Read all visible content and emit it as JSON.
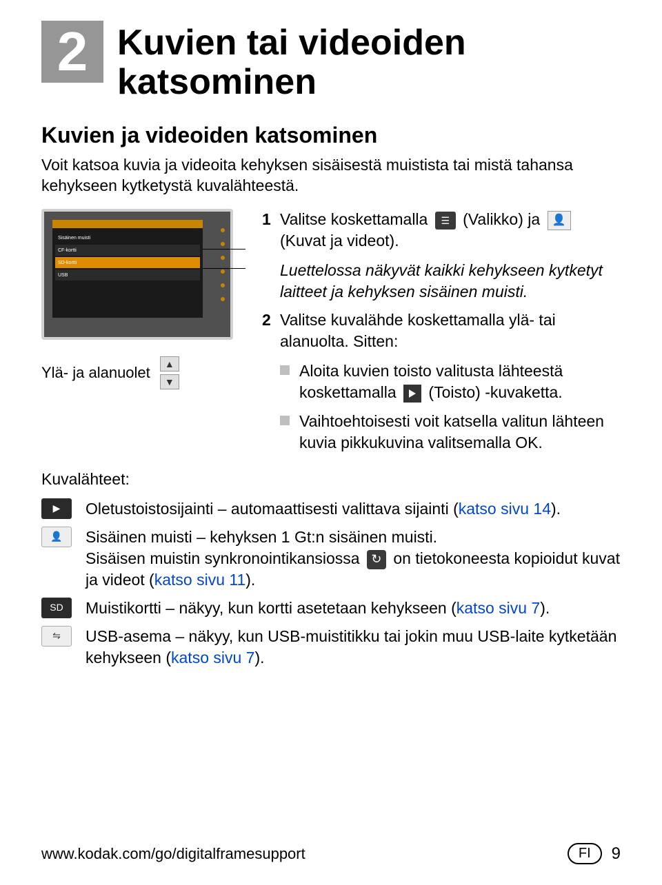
{
  "chapter": {
    "number": "2",
    "title": "Kuvien tai videoiden katsominen"
  },
  "section": {
    "heading": "Kuvien ja videoiden katsominen",
    "intro": "Voit katsoa kuvia ja videoita kehyksen sisäisestä muistista tai mistä tahansa kehykseen kytketystä kuvalähteestä."
  },
  "arrows_label": "Ylä- ja alanuolet",
  "steps": {
    "s1_a": "Valitse koskettamalla ",
    "s1_b": " (Valikko) ja ",
    "s1_c": " (Kuvat ja videot).",
    "s1_note": "Luettelossa näkyvät kaikki kehykseen kytketyt laitteet ja kehyksen sisäinen muisti.",
    "s2_a": "Valitse kuvalähde koskettamalla ylä- tai alanuolta. Sitten:",
    "bullet1_a": "Aloita kuvien toisto valitusta lähteestä koskettamalla ",
    "bullet1_b": " (Toisto) -kuvaketta.",
    "bullet2": "Vaihtoehtoisesti voit katsella valitun lähteen kuvia pikkukuvina valitsemalla OK."
  },
  "sources": {
    "heading": "Kuvalähteet",
    "default_a": "Oletustoistosijainti – automaattisesti valittava sijainti (",
    "default_link": "katso sivu 14",
    "default_b": ").",
    "internal1": "Sisäinen muisti – kehyksen 1 Gt:n sisäinen muisti.",
    "internal2_a": "Sisäisen muistin synkronointikansiossa ",
    "internal2_b": " on tietokoneesta kopioidut kuvat ja videot (",
    "internal2_link": "katso sivu 11",
    "internal2_c": ").",
    "card_a": "Muistikortti – näkyy, kun kortti asetetaan kehykseen (",
    "card_link": "katso sivu 7",
    "card_b": ").",
    "usb_a": "USB-asema – näkyy, kun USB-muistitikku tai jokin muu USB-laite kytketään kehykseen (",
    "usb_link": "katso sivu 7",
    "usb_b": ")."
  },
  "footer": {
    "url": "www.kodak.com/go/digitalframesupport",
    "lang": "FI",
    "page": "9"
  },
  "icons": {
    "menu": "menu-icon",
    "pictures": "pictures-icon",
    "play": "play-icon",
    "sync": "sync-icon",
    "folder_play": "folder-play-icon",
    "internal": "internal-memory-icon",
    "sd": "sd-card-icon",
    "usb": "usb-icon"
  }
}
